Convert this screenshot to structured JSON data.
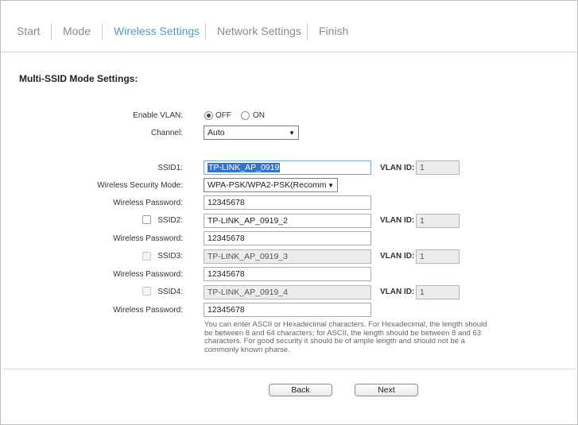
{
  "tabs": [
    {
      "label": "Start",
      "active": false
    },
    {
      "label": "Mode",
      "active": false
    },
    {
      "label": "Wireless Settings",
      "active": true
    },
    {
      "label": "Network Settings",
      "active": false
    },
    {
      "label": "Finish",
      "active": false
    }
  ],
  "section_title": "Multi-SSID Mode Settings:",
  "vlan": {
    "label": "Enable VLAN:",
    "off_label": "OFF",
    "on_label": "ON",
    "selected": "OFF"
  },
  "channel": {
    "label": "Channel:",
    "value": "Auto"
  },
  "ssid1": {
    "label": "SSID1:",
    "value": "TP-LINK_AP_0919",
    "vlan_label": "VLAN ID:",
    "vlan_id": "1"
  },
  "security_mode": {
    "label": "Wireless Security Mode:",
    "value": "WPA-PSK/WPA2-PSK(Recomm"
  },
  "password1": {
    "label": "Wireless Password:",
    "value": "12345678"
  },
  "ssid2": {
    "label": "SSID2:",
    "value": "TP-LINK_AP_0919_2",
    "vlan_label": "VLAN ID:",
    "vlan_id": "1",
    "checked": false
  },
  "password2": {
    "label": "Wireless Password:",
    "value": "12345678"
  },
  "ssid3": {
    "label": "SSID3:",
    "value": "TP-LINK_AP_0919_3",
    "vlan_label": "VLAN ID:",
    "vlan_id": "1",
    "checked": false
  },
  "password3": {
    "label": "Wireless Password:",
    "value": "12345678"
  },
  "ssid4": {
    "label": "SSID4:",
    "value": "TP-LINK_AP_0919_4",
    "vlan_label": "VLAN ID:",
    "vlan_id": "1",
    "checked": false
  },
  "password4": {
    "label": "Wireless Password:",
    "value": "12345678"
  },
  "hint": "You can enter ASCII or Hexadecimal characters. For Hexadecimal, the length should be between 8 and 64 characters; for ASCII, the length should be between 8 and 63 characters. For good security it should be of ample length and should not be a commonly known pharse.",
  "buttons": {
    "back": "Back",
    "next": "Next"
  },
  "colors": {
    "active_tab": "#4a9fcf",
    "inactive_tab": "#8a8a8a",
    "selection": "#3074d0"
  }
}
